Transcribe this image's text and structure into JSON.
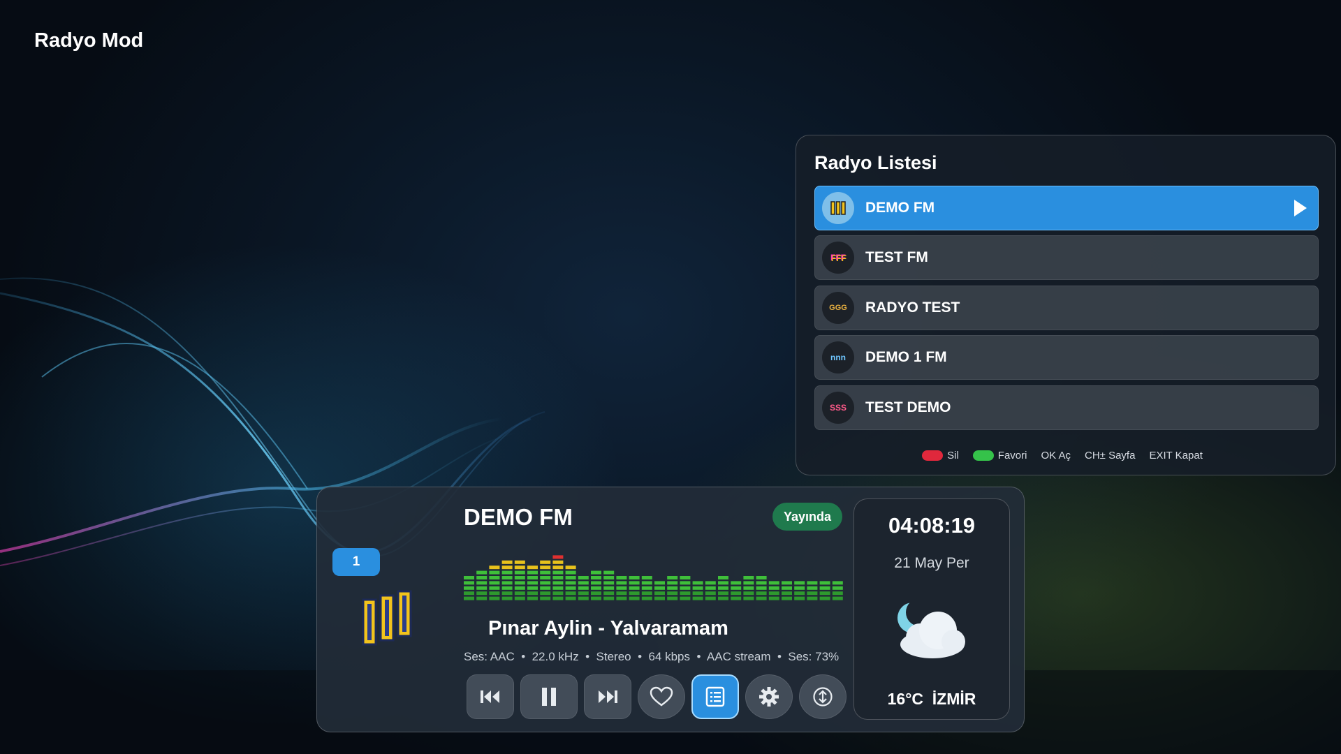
{
  "app": {
    "title": "Radyo Mod"
  },
  "radio_list": {
    "title": "Radyo Listesi",
    "stations": [
      {
        "name": "DEMO FM",
        "logo_text": "|||",
        "active": true
      },
      {
        "name": "TEST FM",
        "logo_text": "FFF",
        "active": false
      },
      {
        "name": "RADYO TEST",
        "logo_text": "GGG",
        "active": false
      },
      {
        "name": "DEMO 1 FM",
        "logo_text": "nnn",
        "active": false
      },
      {
        "name": "TEST DEMO",
        "logo_text": "SSS",
        "active": false
      }
    ],
    "legend": {
      "delete_label": "Sil",
      "delete_color": "#e0283c",
      "favorite_label": "Favori",
      "favorite_color": "#35c24a",
      "ok_label": "OK Aç",
      "ch_label": "CH± Sayfa",
      "exit_label": "EXIT Kapat"
    }
  },
  "player": {
    "channel_number": "1",
    "station_name": "DEMO FM",
    "status": "Yayında",
    "song": "Pınar Aylin - Yalvaramam",
    "info": "Ses: AAC  •  22.0 kHz  •  Stereo  •  64 kbps  •  AAC stream  •  Ses: 73%",
    "equalizer_levels": [
      5,
      6,
      7,
      8,
      8,
      7,
      8,
      9,
      7,
      5,
      6,
      6,
      5,
      5,
      5,
      4,
      5,
      5,
      4,
      4,
      5,
      4,
      5,
      5,
      4,
      4,
      4,
      4,
      4,
      4
    ],
    "controls": [
      "previous-icon",
      "pause-icon",
      "next-icon",
      "heart-icon",
      "list-icon",
      "gear-icon",
      "upload-icon"
    ]
  },
  "clock": {
    "time": "04:08:19",
    "date": "21 May Per",
    "weather_icon": "moon-cloud-icon",
    "temperature_city": "16°C  İZMİR"
  },
  "colors": {
    "accent": "#2a8fdf",
    "live": "#1f7a4d"
  }
}
